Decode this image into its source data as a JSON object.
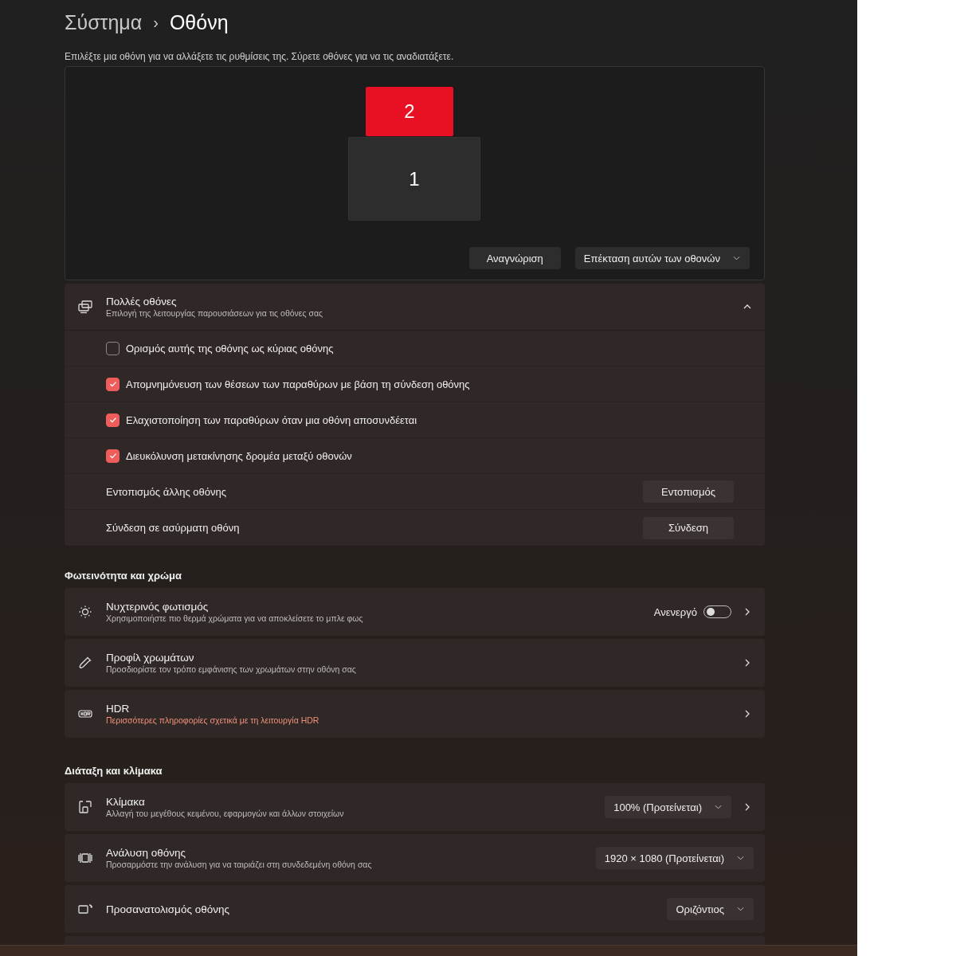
{
  "breadcrumb": {
    "parent": "Σύστημα",
    "separator": "›",
    "current": "Οθόνη"
  },
  "instruction": "Επιλέξτε μια οθόνη για να αλλάξετε τις ρυθμίσεις της. Σύρετε οθόνες για να τις αναδιατάξετε.",
  "arrangement": {
    "monitors": [
      {
        "label": "2",
        "selected": true
      },
      {
        "label": "1",
        "selected": false
      }
    ],
    "identify_button": "Αναγνώριση",
    "mode_dropdown": "Επέκταση αυτών των οθονών"
  },
  "multiple_displays": {
    "title": "Πολλές οθόνες",
    "subtitle": "Επιλογή της λειτουργίας παρουσιάσεων για τις οθόνες σας",
    "expanded": true,
    "rows": [
      {
        "kind": "checkbox",
        "label": "Ορισμός αυτής της οθόνης ως κύριας οθόνης",
        "checked": false
      },
      {
        "kind": "checkbox",
        "label": "Απομνημόνευση των θέσεων των παραθύρων με βάση τη σύνδεση οθόνης",
        "checked": true
      },
      {
        "kind": "checkbox",
        "label": "Ελαχιστοποίηση των παραθύρων όταν μια οθόνη αποσυνδέεται",
        "checked": true
      },
      {
        "kind": "checkbox",
        "label": "Διευκόλυνση μετακίνησης δρομέα μεταξύ οθονών",
        "checked": true
      },
      {
        "kind": "button",
        "label": "Εντοπισμός άλλης οθόνης",
        "button": "Εντοπισμός"
      },
      {
        "kind": "button",
        "label": "Σύνδεση σε ασύρματη οθόνη",
        "button": "Σύνδεση"
      }
    ]
  },
  "sections": [
    {
      "heading": "Φωτεινότητα και χρώμα",
      "items": [
        {
          "kind": "toggle",
          "title": "Νυχτερινός φωτισμός",
          "subtitle": "Χρησιμοποιήστε πιο θερμά χρώματα για να αποκλείσετε το μπλε φως",
          "link": false,
          "value_label": "Ανενεργό",
          "on": false
        },
        {
          "kind": "chevron",
          "title": "Προφίλ χρωμάτων",
          "subtitle": "Προσδιορίστε τον τρόπο εμφάνισης των χρωμάτων στην οθόνη σας",
          "link": false
        },
        {
          "kind": "chevron",
          "title": "HDR",
          "subtitle": "Περισσότερες πληροφορίες σχετικά με τη λειτουργία HDR",
          "link": true
        }
      ]
    },
    {
      "heading": "Διάταξη και κλίμακα",
      "items": [
        {
          "kind": "dropdown_chevron",
          "title": "Κλίμακα",
          "subtitle": "Αλλαγή του μεγέθους κειμένου, εφαρμογών και άλλων στοιχείων",
          "link": false,
          "value": "100% (Προτείνεται)"
        },
        {
          "kind": "dropdown",
          "title": "Ανάλυση οθόνης",
          "subtitle": "Προσαρμόστε  την ανάλυση για να ταιριάζει στη συνδεδεμένη οθόνη σας",
          "link": false,
          "value": "1920 × 1080 (Προτείνεται)"
        },
        {
          "kind": "dropdown",
          "title": "Προσανατολισμός οθόνης",
          "value": "Οριζόντιος"
        }
      ]
    }
  ]
}
